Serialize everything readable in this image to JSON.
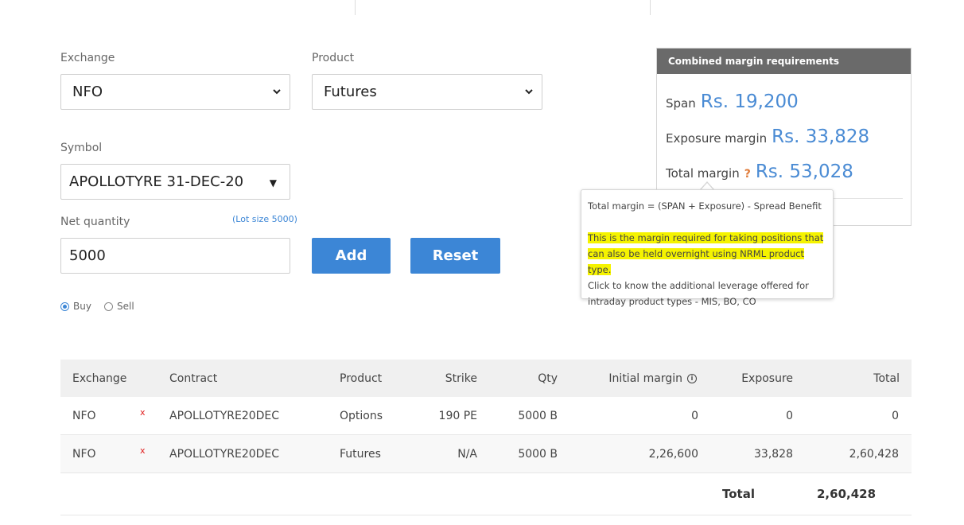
{
  "form": {
    "exchange": {
      "label": "Exchange",
      "value": "NFO"
    },
    "product": {
      "label": "Product",
      "value": "Futures"
    },
    "symbol": {
      "label": "Symbol",
      "value": "APOLLOTYRE 31-DEC-20"
    },
    "net_quantity": {
      "label": "Net quantity",
      "value": "5000",
      "lot_size": "(Lot size 5000)"
    },
    "add_label": "Add",
    "reset_label": "Reset",
    "buy_label": "Buy",
    "sell_label": "Sell",
    "selected_side": "Buy"
  },
  "margin_card": {
    "title": "Combined margin requirements",
    "span_label": "Span",
    "span_value": "Rs. 19,200",
    "exposure_label": "Exposure margin",
    "exposure_value": "Rs. 33,828",
    "total_label": "Total margin",
    "help_mark": "?",
    "total_value": "Rs. 53,028"
  },
  "tooltip": {
    "line1": "Total margin = (SPAN + Exposure) - Spread Benefit",
    "highlight_1": "This is the margin required for taking positions that",
    "highlight_2": "can also be held overnight using NRML product type.",
    "line3": "Click to know the additional leverage offered for",
    "line4": "intraday product types - MIS, BO, CO"
  },
  "table": {
    "headers": {
      "exchange": "Exchange",
      "contract": "Contract",
      "product": "Product",
      "strike": "Strike",
      "qty": "Qty",
      "initial_margin": "Initial margin",
      "exposure": "Exposure",
      "total": "Total"
    },
    "remove_mark": "x",
    "rows": [
      {
        "exchange": "NFO",
        "contract": "APOLLOTYRE20DEC",
        "product": "Options",
        "strike": "190 PE",
        "qty": "5000 B",
        "initial_margin": "0",
        "exposure": "0",
        "total": "0"
      },
      {
        "exchange": "NFO",
        "contract": "APOLLOTYRE20DEC",
        "product": "Futures",
        "strike": "N/A",
        "qty": "5000 B",
        "initial_margin": "2,26,600",
        "exposure": "33,828",
        "total": "2,60,428"
      }
    ],
    "total_label": "Total",
    "total_value": "2,60,428"
  },
  "colors": {
    "accent": "#3c86d6",
    "margin_value": "#4a8bd4",
    "highlight": "#f5f300",
    "card_header": "#6a6a6a",
    "remove_mark": "#e02020"
  },
  "icons": [
    "chevron-down-icon",
    "dropdown-triangle-icon",
    "info-icon",
    "remove-icon",
    "help-icon"
  ]
}
